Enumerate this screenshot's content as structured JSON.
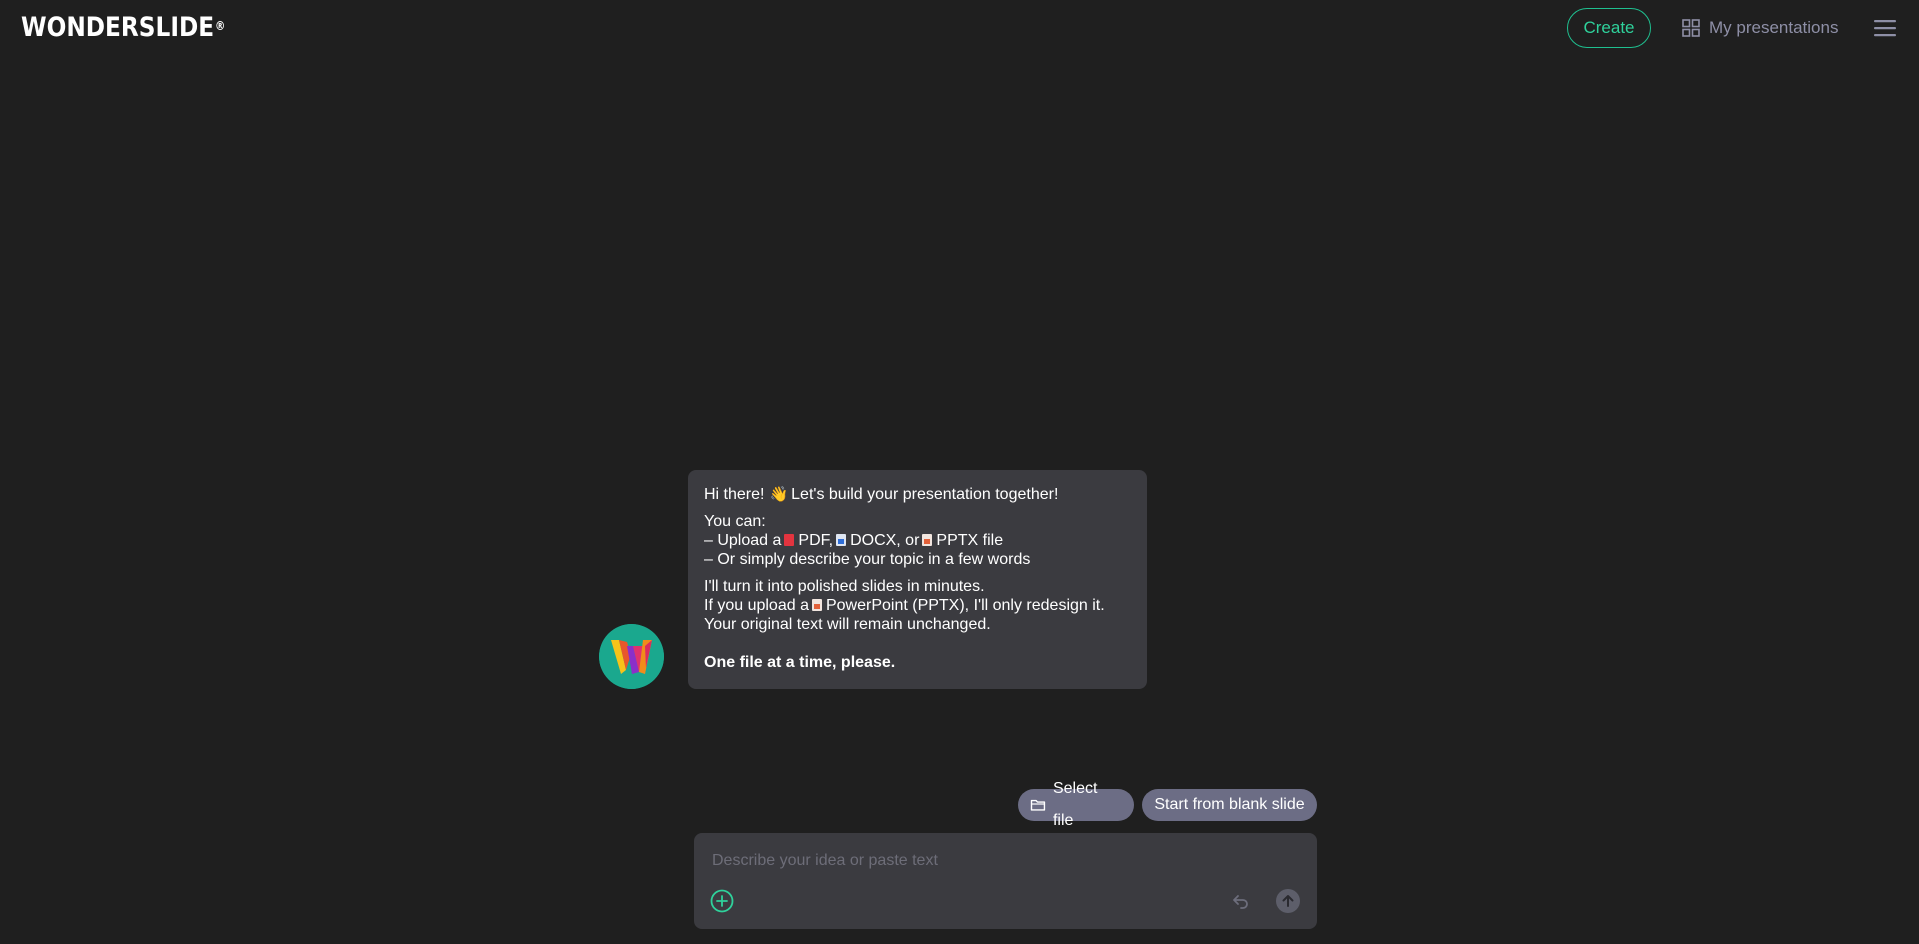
{
  "header": {
    "logo": "WONDERSLIDE",
    "logo_mark": "®",
    "create_label": "Create",
    "my_presentations_label": "My presentations",
    "grid_icon": "grid-icon",
    "menu_icon": "hamburger-menu-icon"
  },
  "chat": {
    "greeting": "Hi there!",
    "greeting_wave": "👋",
    "greeting_rest": "Let's build your presentation together!",
    "you_can": "You can:",
    "upload_prefix": "– Upload a",
    "pdf": "PDF,",
    "docx": "DOCX, or",
    "pptx": "PPTX file",
    "describe": "– Or simply describe your topic in a few words",
    "turn_into": "I'll turn it into polished slides in minutes.",
    "pptx_prefix": "If you upload a",
    "pptx_rest": "PowerPoint (PPTX), I'll only redesign it.",
    "original_text": "Your original text will remain unchanged.",
    "one_file": "One file at a time, please."
  },
  "actions": {
    "select_file": "Select file",
    "blank_slide": "Start from blank slide"
  },
  "composer": {
    "placeholder": "Describe your idea or paste text",
    "value": ""
  },
  "colors": {
    "background": "#1f1f1f",
    "accent": "#2fd19b",
    "bubble": "#3b3b40",
    "pill": "#6c6d85"
  }
}
